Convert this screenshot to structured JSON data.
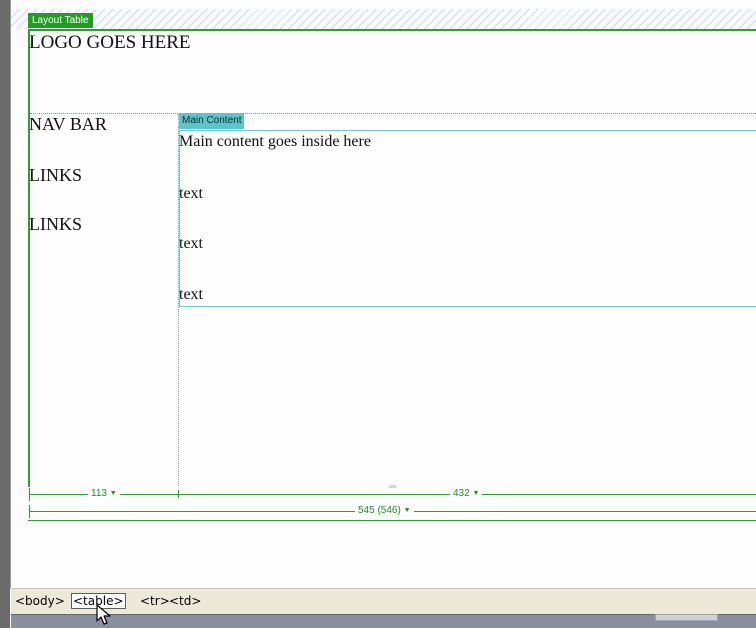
{
  "layout_table": {
    "label": "Layout Table",
    "logo_text": "LOGO GOES HERE",
    "nav": [
      "NAV BAR",
      "LINKS",
      "LINKS"
    ]
  },
  "main_content": {
    "label": "Main Content",
    "lines": [
      "Main content goes inside here",
      "text",
      "text",
      "text"
    ]
  },
  "width_indicators": {
    "col1": "113",
    "col2": "432",
    "table": "545 (546)"
  },
  "tag_selector": {
    "tags": [
      "<body>",
      "<table>",
      "<tr>",
      "<td>"
    ],
    "selected_index": 1
  },
  "colors": {
    "layout_table_accent": "#1f9f1f",
    "main_content_accent": "#5fc4c9"
  }
}
